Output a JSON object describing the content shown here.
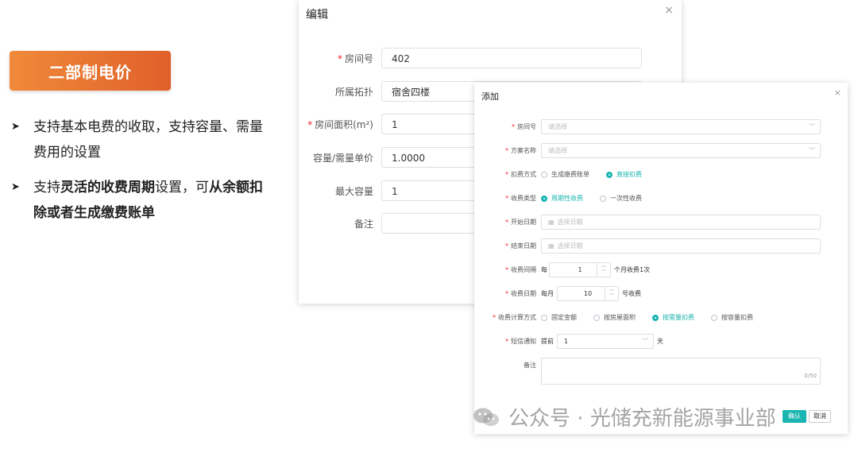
{
  "slide": {
    "badge": "二部制电价",
    "bullets": [
      {
        "parts": [
          "支持基本电费的收取，支持容量、需量费用的设置"
        ]
      },
      {
        "p1": "支持",
        "b1": "灵活的收费周期",
        "p2": "设置，可",
        "b2": "从余额扣除或者生成缴费账单"
      }
    ]
  },
  "edit_dialog": {
    "title": "编辑",
    "close": "×",
    "fields": [
      {
        "label": "房间号",
        "required": true,
        "value": "402"
      },
      {
        "label": "所属拓扑",
        "required": false,
        "value": "宿舍四楼"
      },
      {
        "label": "房间面积(m²)",
        "required": true,
        "value": "1"
      },
      {
        "label": "容量/需量单价",
        "required": false,
        "value": "1.0000"
      },
      {
        "label": "最大容量",
        "required": false,
        "value": "1"
      },
      {
        "label": "备注",
        "required": false,
        "value": ""
      }
    ]
  },
  "add_dialog": {
    "title": "添加",
    "close": "×",
    "room": {
      "label": "房间号",
      "placeholder": "请选择"
    },
    "plan": {
      "label": "方案名称",
      "placeholder": "请选择"
    },
    "deduct": {
      "label": "扣费方式",
      "options": [
        "生成缴费账单",
        "直接扣费"
      ],
      "selected": 1
    },
    "charge_type": {
      "label": "收费类型",
      "options": [
        "周期性收费",
        "一次性收费"
      ],
      "selected": 0
    },
    "start_date": {
      "label": "开始日期",
      "placeholder": "选择日期"
    },
    "end_date": {
      "label": "结束日期",
      "placeholder": "选择日期"
    },
    "interval": {
      "label": "收费间隔",
      "prefix": "每",
      "value": "1",
      "suffix": "个月收费1次"
    },
    "charge_day": {
      "label": "收费日期",
      "prefix": "每月",
      "value": "10",
      "suffix": "号收费"
    },
    "calc": {
      "label": "收费计算方式",
      "options": [
        "固定金额",
        "按房屋面积",
        "按需量扣费",
        "按容量扣费"
      ],
      "selected": 2
    },
    "sms": {
      "label": "短信通知",
      "prefix": "提前",
      "value": "1",
      "suffix": "天"
    },
    "remark": {
      "label": "备注",
      "counter": "0/50"
    },
    "ok": "确认",
    "cancel": "取消"
  },
  "watermark": "公众号 · 光储充新能源事业部",
  "colors": {
    "accent": "#1ab5b0",
    "badge": "#e8732f"
  }
}
